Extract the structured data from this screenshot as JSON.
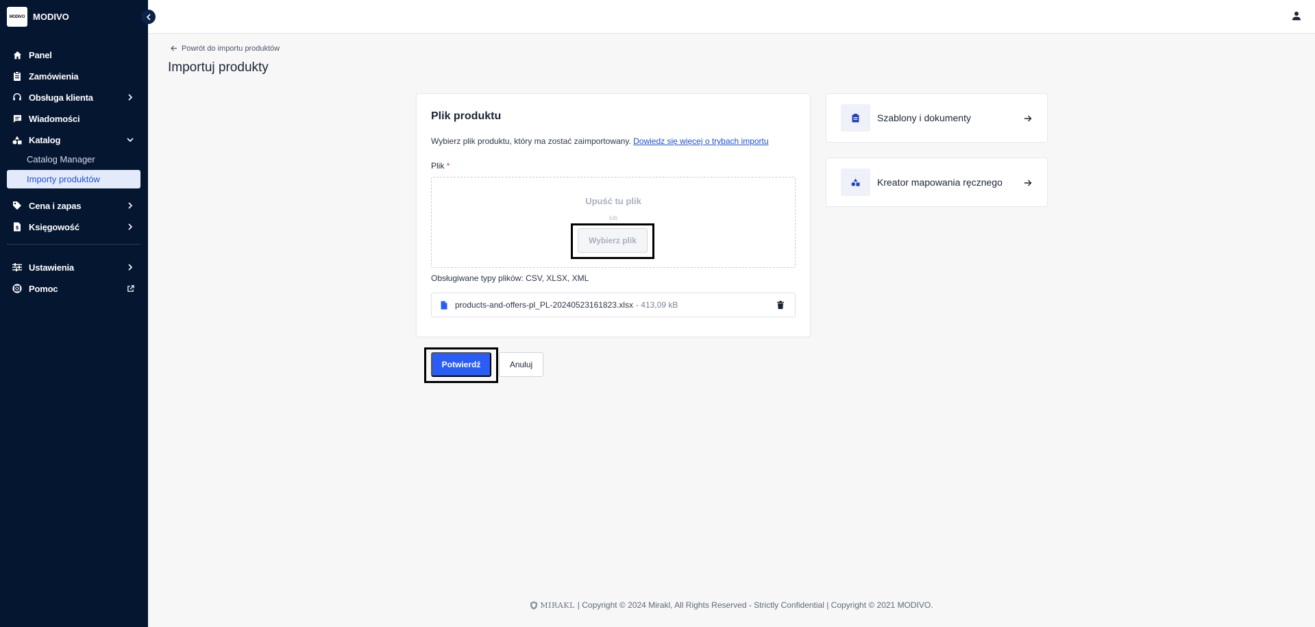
{
  "brand": {
    "logo_text": "MODIVO",
    "name": "MODIVO"
  },
  "sidebar": {
    "items": [
      {
        "label": "Panel",
        "icon": "home-icon"
      },
      {
        "label": "Zamówienia",
        "icon": "clipboard-icon"
      },
      {
        "label": "Obsługa klienta",
        "icon": "headset-icon"
      },
      {
        "label": "Wiadomości",
        "icon": "chat-icon"
      },
      {
        "label": "Katalog",
        "icon": "shapes-icon"
      },
      {
        "label": "Cena i zapas",
        "icon": "tag-icon"
      },
      {
        "label": "Księgowość",
        "icon": "invoice-icon"
      },
      {
        "label": "Ustawienia",
        "icon": "sliders-icon"
      },
      {
        "label": "Pomoc",
        "icon": "lifebuoy-icon"
      }
    ],
    "catalog_sub": [
      {
        "label": "Catalog Manager"
      },
      {
        "label": "Importy produktów"
      }
    ]
  },
  "header": {
    "back_label": "Powrót do importu produktów",
    "title": "Importuj produkty"
  },
  "card": {
    "title": "Plik produktu",
    "description": "Wybierz plik produktu, który ma zostać zaimportowany.",
    "learn_more": "Dowiedz się więcej o trybach importu",
    "field_label": "Plik",
    "required_mark": "*",
    "drop_text": "Upuść tu plik",
    "or_text": "lub",
    "choose_button": "Wybierz plik",
    "supported_types": "Obsługiwane typy plików: CSV, XLSX, XML",
    "file_name": "products-and-offers-pl_PL-20240523161823.xlsx",
    "file_size": "- 413,09 kB"
  },
  "actions": {
    "confirm": "Potwierdź",
    "cancel": "Anuluj"
  },
  "side_cards": [
    {
      "label": "Szablony i dokumenty",
      "icon": "document-icon"
    },
    {
      "label": "Kreator mapowania ręcznego",
      "icon": "shapes-icon"
    }
  ],
  "footer": {
    "mirakl": "MIRAKL",
    "text": "| Copyright © 2024 Mirakl, All Rights Reserved - Strictly Confidential | Copyright © 2021 MODIVO."
  },
  "colors": {
    "sidebar_bg": "#051630",
    "accent": "#2a5df5",
    "link": "#1e4fd9",
    "active_sub_bg": "#e3ebfb"
  }
}
